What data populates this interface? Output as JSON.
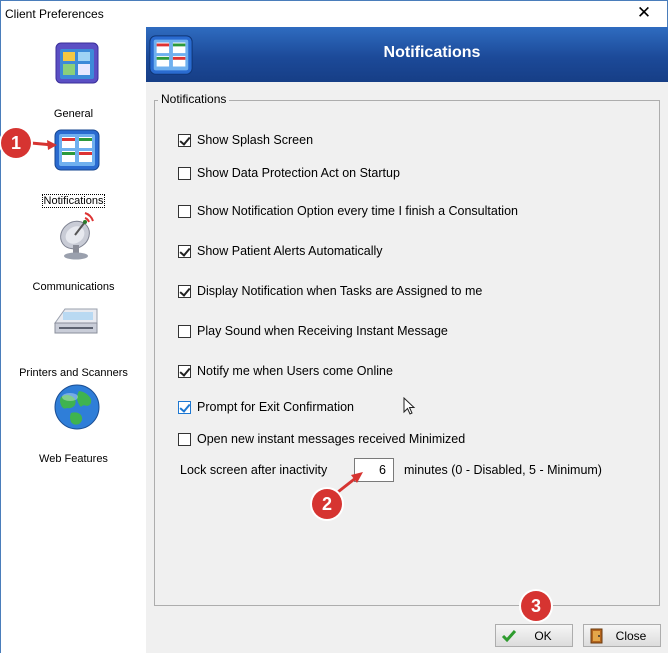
{
  "window": {
    "title": "Client Preferences",
    "close_glyph": "✕"
  },
  "sidebar": {
    "items": [
      {
        "label": "General",
        "icon": "general-icon"
      },
      {
        "label": "Notifications",
        "icon": "notifications-icon",
        "selected": true
      },
      {
        "label": "Communications",
        "icon": "satellite-dish-icon"
      },
      {
        "label": "Printers and Scanners",
        "icon": "scanner-icon"
      },
      {
        "label": "Web Features",
        "icon": "globe-icon"
      }
    ]
  },
  "header": {
    "title": "Notifications"
  },
  "group": {
    "legend": "Notifications",
    "options": [
      {
        "label": "Show Splash Screen",
        "checked": true
      },
      {
        "label": "Show Data Protection Act on Startup",
        "checked": false
      },
      {
        "label": "Show Notification Option every time I finish a Consultation",
        "checked": false
      },
      {
        "label": "Show Patient Alerts Automatically",
        "checked": true
      },
      {
        "label": "Display Notification when Tasks are Assigned to me",
        "checked": true
      },
      {
        "label": "Play Sound when Receiving Instant Message",
        "checked": false
      },
      {
        "label": "Notify me when Users come Online",
        "checked": true
      },
      {
        "label": "Prompt for Exit Confirmation",
        "checked": true,
        "focused": true
      },
      {
        "label": "Open new instant messages received Minimized",
        "checked": false
      }
    ],
    "lock": {
      "label": "Lock screen after inactivity",
      "value": "6",
      "suffix": "minutes (0 - Disabled, 5 - Minimum)"
    }
  },
  "buttons": {
    "ok": "OK",
    "close": "Close"
  },
  "callouts": {
    "one": "1",
    "two": "2",
    "three": "3"
  },
  "colors": {
    "header": "#1c4a99",
    "callout": "#d63431",
    "panel": "#f0f0f0"
  }
}
